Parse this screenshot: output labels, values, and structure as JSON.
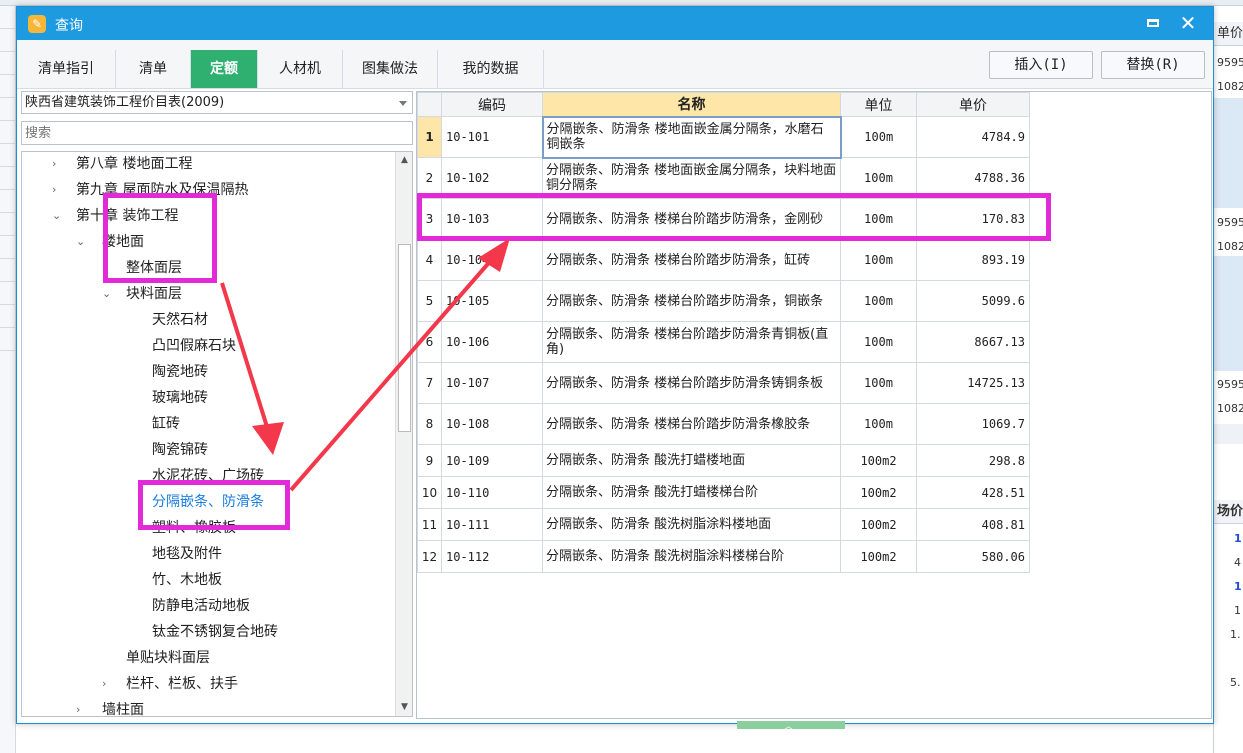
{
  "background": {
    "right_col": [
      "单价",
      "9595",
      "1082",
      "9595",
      "1082",
      "9595",
      "1082",
      "场价",
      "1",
      "4",
      "1",
      "1",
      "1.",
      "5."
    ]
  },
  "dialog": {
    "title": "查询",
    "title_icon": "query-app-icon",
    "maximize_icon": "maximize-icon",
    "close_icon": "close-icon",
    "close_glyph": "✕"
  },
  "tabs": [
    "清单指引",
    "清单",
    "定额",
    "人材机",
    "图集做法",
    "我的数据"
  ],
  "active_tab": "定额",
  "buttons": {
    "insert": "插入(I)",
    "replace": "替换(R)"
  },
  "library_select": {
    "value": "陕西省建筑装饰工程价目表(2009)"
  },
  "search": {
    "placeholder": "搜索"
  },
  "tree": [
    {
      "label": "第八章 楼地面工程",
      "level": 1,
      "arrow": "›"
    },
    {
      "label": "第九章 屋面防水及保温隔热",
      "level": 1,
      "arrow": "›"
    },
    {
      "label": "第十章 装饰工程",
      "level": 1,
      "arrow": "⌄"
    },
    {
      "label": "楼地面",
      "level": 2,
      "arrow": "⌄"
    },
    {
      "label": "整体面层",
      "level": 3,
      "arrow": ""
    },
    {
      "label": "块料面层",
      "level": 3,
      "arrow": "⌄"
    },
    {
      "label": "天然石材",
      "level": 4,
      "arrow": ""
    },
    {
      "label": "凸凹假麻石块",
      "level": 4,
      "arrow": ""
    },
    {
      "label": "陶瓷地砖",
      "level": 4,
      "arrow": ""
    },
    {
      "label": "玻璃地砖",
      "level": 4,
      "arrow": ""
    },
    {
      "label": "缸砖",
      "level": 4,
      "arrow": ""
    },
    {
      "label": "陶瓷锦砖",
      "level": 4,
      "arrow": ""
    },
    {
      "label": "水泥花砖、广场砖",
      "level": 4,
      "arrow": ""
    },
    {
      "label": "分隔嵌条、防滑条",
      "level": 4,
      "arrow": "",
      "selected": true
    },
    {
      "label": "塑料、橡胶板",
      "level": 4,
      "arrow": ""
    },
    {
      "label": "地毯及附件",
      "level": 4,
      "arrow": ""
    },
    {
      "label": "竹、木地板",
      "level": 4,
      "arrow": ""
    },
    {
      "label": "防静电活动地板",
      "level": 4,
      "arrow": ""
    },
    {
      "label": "钛金不锈钢复合地砖",
      "level": 4,
      "arrow": ""
    },
    {
      "label": "单贴块料面层",
      "level": 3,
      "arrow": ""
    },
    {
      "label": "栏杆、栏板、扶手",
      "level": 3,
      "arrow": "›"
    },
    {
      "label": "墙柱面",
      "level": 2,
      "arrow": "›"
    }
  ],
  "grid": {
    "columns": [
      "编码",
      "名称",
      "单位",
      "单价"
    ],
    "rows": [
      {
        "idx": "1",
        "code": "10-101",
        "name": "分隔嵌条、防滑条 楼地面嵌金属分隔条，水磨石铜嵌条",
        "unit": "100m",
        "price": "4784.9"
      },
      {
        "idx": "2",
        "code": "10-102",
        "name": "分隔嵌条、防滑条 楼地面嵌金属分隔条，块料地面铜分隔条",
        "unit": "100m",
        "price": "4788.36"
      },
      {
        "idx": "3",
        "code": "10-103",
        "name": "分隔嵌条、防滑条 楼梯台阶踏步防滑条，金刚砂",
        "unit": "100m",
        "price": "170.83"
      },
      {
        "idx": "4",
        "code": "10-104",
        "name": "分隔嵌条、防滑条 楼梯台阶踏步防滑条，缸砖",
        "unit": "100m",
        "price": "893.19"
      },
      {
        "idx": "5",
        "code": "10-105",
        "name": "分隔嵌条、防滑条 楼梯台阶踏步防滑条，铜嵌条",
        "unit": "100m",
        "price": "5099.6"
      },
      {
        "idx": "6",
        "code": "10-106",
        "name": "分隔嵌条、防滑条 楼梯台阶踏步防滑条青铜板(直角)",
        "unit": "100m",
        "price": "8667.13"
      },
      {
        "idx": "7",
        "code": "10-107",
        "name": "分隔嵌条、防滑条 楼梯台阶踏步防滑条铸铜条板",
        "unit": "100m",
        "price": "14725.13"
      },
      {
        "idx": "8",
        "code": "10-108",
        "name": "分隔嵌条、防滑条 楼梯台阶踏步防滑条橡胶条",
        "unit": "100m",
        "price": "1069.7"
      },
      {
        "idx": "9",
        "code": "10-109",
        "name": "分隔嵌条、防滑条 酸洗打蜡楼地面",
        "unit": "100m2",
        "price": "298.8"
      },
      {
        "idx": "10",
        "code": "10-110",
        "name": "分隔嵌条、防滑条 酸洗打蜡楼梯台阶",
        "unit": "100m2",
        "price": "428.51"
      },
      {
        "idx": "11",
        "code": "10-111",
        "name": "分隔嵌条、防滑条 酸洗树脂涂料楼地面",
        "unit": "100m2",
        "price": "408.81"
      },
      {
        "idx": "12",
        "code": "10-112",
        "name": "分隔嵌条、防滑条 酸洗树脂涂料楼梯台阶",
        "unit": "100m2",
        "price": "580.06"
      }
    ]
  },
  "colors": {
    "title_bar": "#1e9ae0",
    "active_tab": "#2fb070",
    "annotation": "#e22ad8",
    "arrow": "#f2384a",
    "selected_text": "#1a7ee0"
  }
}
